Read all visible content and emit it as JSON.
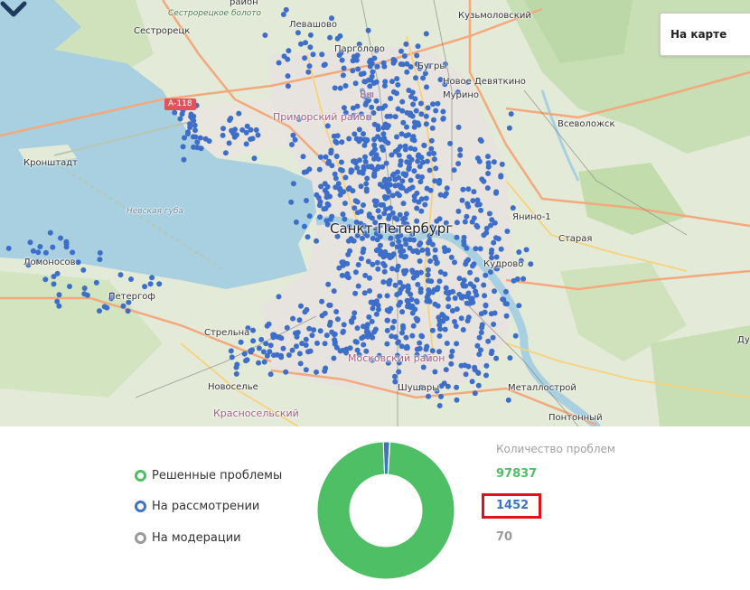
{
  "map": {
    "layer_button": "На карте",
    "road_shield": "А-118",
    "labels": {
      "sestroretsk": "Сестрорецк",
      "marsh": "Сестрорецкое болото",
      "district_top": "район",
      "kuzmolovsky": "Кузьмоловский",
      "levashovo": "Левашово",
      "pargolovo": "Парголово",
      "bugry": "Бугры",
      "novoe_devyatkino": "Новое Девяткино",
      "murino": "Мурино",
      "primorsky": "Приморский район",
      "vyborgsky_partial": "Вы",
      "vsevolozhsk": "Всеволожск",
      "kronshtadt": "Кронштадт",
      "nevskaya_guba": "Невская губа",
      "spb": "Санкт-Петербург",
      "yanino": "Янино-1",
      "staraya": "Старая",
      "lomonosov": "Ломоносов",
      "kudrovo": "Кудрово",
      "petergof": "Петергоф",
      "strelna": "Стрельна",
      "moskovsky": "Московский район",
      "novoselye": "Новоселье",
      "krasnoselsky": "Красносельский",
      "shushary": "Шушары",
      "metallostroy": "Металлострой",
      "pontonny": "Понтонный",
      "du_partial": "Ду"
    }
  },
  "stats": {
    "legend": [
      {
        "label": "Решенные проблемы",
        "color": "#4ebf64"
      },
      {
        "label": "На рассмотрении",
        "color": "#3d74c4"
      },
      {
        "label": "На модерации",
        "color": "#9a9a9a"
      }
    ],
    "count_title": "Количество проблем",
    "counts": [
      {
        "value": "97837",
        "raw": 97837,
        "color": "#4ebf64"
      },
      {
        "value": "1452",
        "raw": 1452,
        "color": "#3d74c4"
      },
      {
        "value": "70",
        "raw": 70,
        "color": "#9a9a9a"
      }
    ]
  }
}
